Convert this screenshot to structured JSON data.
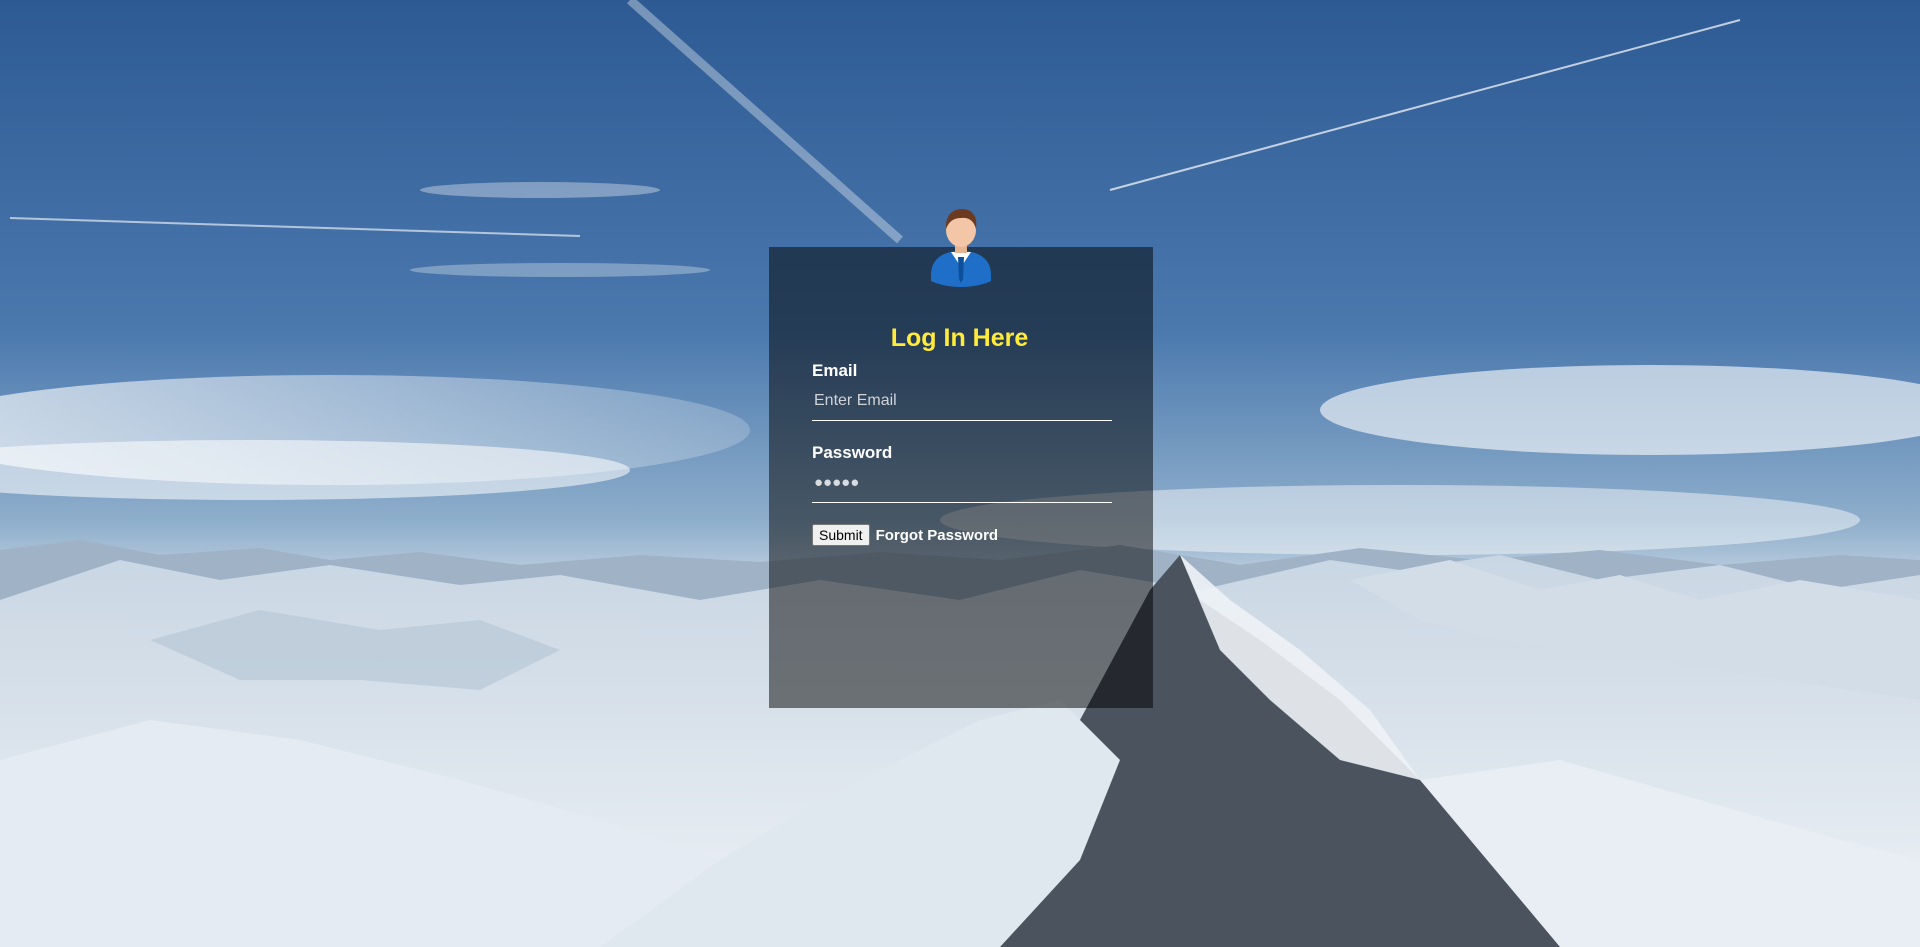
{
  "background": {
    "description_icon": "mountain-landscape-icon",
    "sky_color_top": "#2f5c95",
    "sky_color_bottom": "#9fb8d0",
    "snow_color": "#e6edf4",
    "rock_color": "#3e4650"
  },
  "login_form": {
    "avatar_icon": "user-avatar-icon",
    "title": "Log In Here",
    "title_color": "#ffeb3b",
    "email": {
      "label": "Email",
      "placeholder": "Enter Email",
      "value": ""
    },
    "password": {
      "label": "Password",
      "masked_value": "●●●●●"
    },
    "submit_label": "Submit",
    "forgot_password_label": "Forgot Password"
  }
}
